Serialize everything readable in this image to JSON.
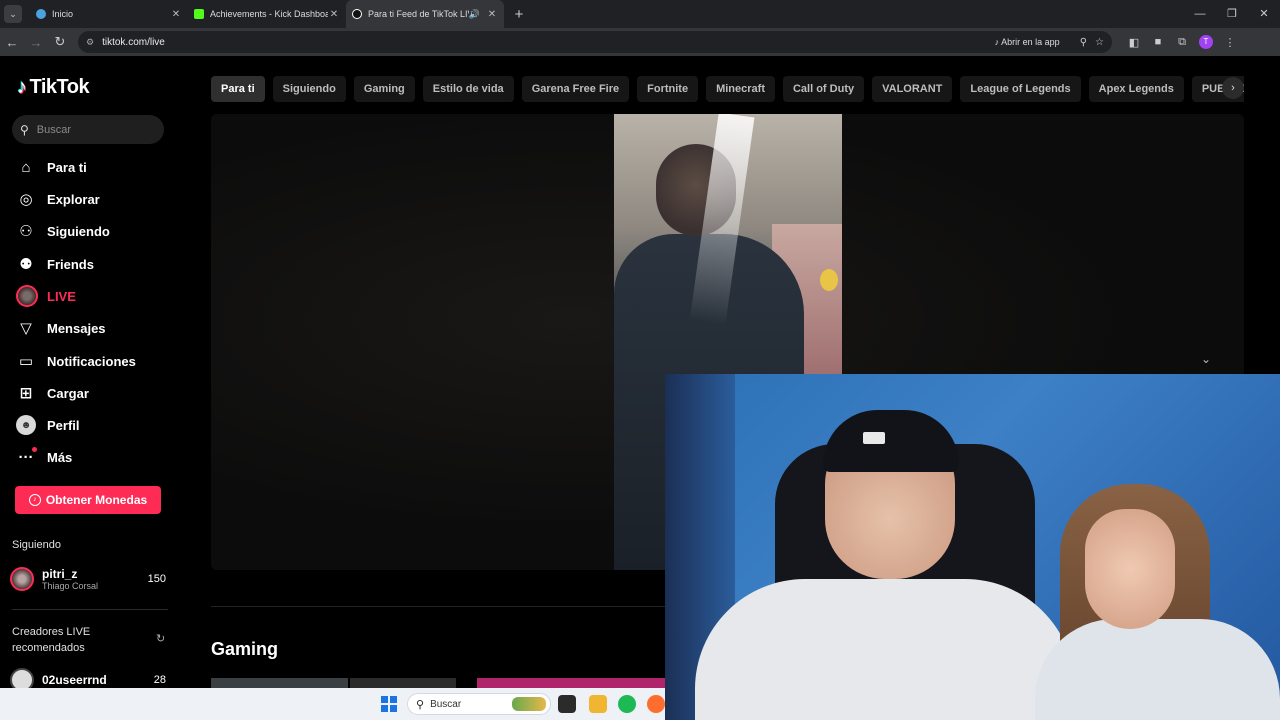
{
  "browser": {
    "tabs": [
      {
        "title": "Inicio",
        "favicon_color": "#4aa3df",
        "active": false
      },
      {
        "title": "Achievements - Kick Dashboard",
        "favicon_color": "#53fc18",
        "active": false
      },
      {
        "title": "Para ti Feed de TikTok LIVE",
        "favicon_color": "#ffffff",
        "active": true
      }
    ],
    "url": "tiktok.com/live",
    "open_in_app_label": "Abrir en la app",
    "profile_initial": "T"
  },
  "tiktok": {
    "logo_text": "TikTok",
    "search_placeholder": "Buscar",
    "nav": [
      {
        "label": "Para ti",
        "icon": "home-icon"
      },
      {
        "label": "Explorar",
        "icon": "compass-icon"
      },
      {
        "label": "Siguiendo",
        "icon": "following-icon"
      },
      {
        "label": "Friends",
        "icon": "friends-icon"
      },
      {
        "label": "LIVE",
        "icon": "live-avatar"
      },
      {
        "label": "Mensajes",
        "icon": "send-icon"
      },
      {
        "label": "Notificaciones",
        "icon": "inbox-icon"
      },
      {
        "label": "Cargar",
        "icon": "upload-icon"
      },
      {
        "label": "Perfil",
        "icon": "profile-avatar"
      },
      {
        "label": "Más",
        "icon": "more-icon"
      }
    ],
    "coins_button": "Obtener Monedas",
    "following_section_label": "Siguiendo",
    "following": [
      {
        "username": "pitri_z",
        "display_name": "Thiago Corsal",
        "count": "150"
      }
    ],
    "recommended_section_label": "Creadores LIVE recomendados",
    "recommended": [
      {
        "username": "02useerrnd",
        "count": "28"
      }
    ],
    "categories": [
      "Para ti",
      "Siguiendo",
      "Gaming",
      "Estilo de vida",
      "Garena Free Fire",
      "Fortnite",
      "Minecraft",
      "Call of Duty",
      "VALORANT",
      "League of Legends",
      "Apex Legends",
      "PUBG: BATTLEGROU"
    ],
    "active_category": "Para ti",
    "gaming_heading": "Gaming"
  },
  "taskbar": {
    "search_placeholder": "Buscar"
  },
  "colors": {
    "tiktok_red": "#fe2c55",
    "chrome_dark": "#202124",
    "chrome_tab_active": "#35363a"
  }
}
